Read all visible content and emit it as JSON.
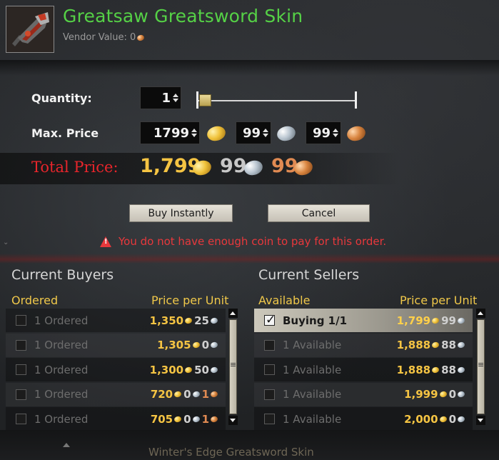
{
  "item": {
    "title": "Greatsaw Greatsword Skin",
    "vendor_label": "Vendor Value:",
    "vendor_value": "0",
    "icon": "greatsaw-sword-icon"
  },
  "form": {
    "quantity_label": "Quantity:",
    "quantity_value": "1",
    "quantity_fraction": 0,
    "max_price_label": "Max. Price",
    "max_gold": "1799",
    "max_silver": "99",
    "max_copper": "99",
    "total_label": "Total Price:",
    "total_gold": "1,799",
    "total_silver": "99",
    "total_copper": "99"
  },
  "buttons": {
    "buy": "Buy Instantly",
    "cancel": "Cancel"
  },
  "error": "You do not have enough coin to pay for this order.",
  "buyers": {
    "title": "Current Buyers",
    "col_left": "Ordered",
    "col_right": "Price per Unit",
    "rows": [
      {
        "label": "1 Ordered",
        "gold": "1,350",
        "silver": "25",
        "copper": ""
      },
      {
        "label": "1 Ordered",
        "gold": "1,305",
        "silver": "0",
        "copper": ""
      },
      {
        "label": "1 Ordered",
        "gold": "1,300",
        "silver": "50",
        "copper": ""
      },
      {
        "label": "1 Ordered",
        "gold": "720",
        "silver": "0",
        "copper": "1"
      },
      {
        "label": "1 Ordered",
        "gold": "705",
        "silver": "0",
        "copper": "1"
      }
    ]
  },
  "sellers": {
    "title": "Current Sellers",
    "col_left": "Available",
    "col_right": "Price per Unit",
    "rows": [
      {
        "label": "Buying 1/1",
        "gold": "1,799",
        "silver": "99",
        "copper": "",
        "checked": true
      },
      {
        "label": "1 Available",
        "gold": "1,888",
        "silver": "88",
        "copper": "",
        "checked": false
      },
      {
        "label": "1 Available",
        "gold": "1,888",
        "silver": "88",
        "copper": "",
        "checked": false
      },
      {
        "label": "1 Available",
        "gold": "1,999",
        "silver": "0",
        "copper": "",
        "checked": false
      },
      {
        "label": "1 Available",
        "gold": "2,000",
        "silver": "0",
        "copper": "",
        "checked": false
      }
    ]
  },
  "footer": {
    "next_item": "Winter's Edge Greatsword Skin"
  },
  "colors": {
    "title_green": "#55d146",
    "total_red": "#e8252b",
    "gold": "#f5c443",
    "silver": "#d0d0d0",
    "copper": "#e08a52",
    "error_red": "#e8383c"
  }
}
